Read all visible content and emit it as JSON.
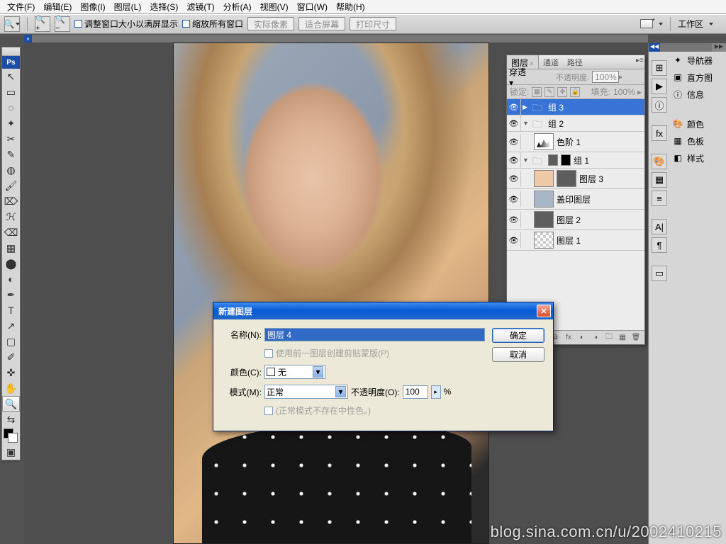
{
  "menubar": [
    "文件(F)",
    "编辑(E)",
    "图像(I)",
    "图层(L)",
    "选择(S)",
    "滤镜(T)",
    "分析(A)",
    "视图(V)",
    "窗口(W)",
    "帮助(H)"
  ],
  "optionbar": {
    "resize_check": "调整窗口大小以满屏显示",
    "zoom_all": "缩放所有窗口",
    "btn_actual": "实际像素",
    "btn_fit": "适合屏幕",
    "btn_print": "打印尺寸",
    "workspace_label": "工作区",
    "arrow": "▼"
  },
  "tools": [
    {
      "icon": "↖",
      "name": "move"
    },
    {
      "icon": "▭",
      "name": "marquee"
    },
    {
      "icon": "◌",
      "name": "lasso"
    },
    {
      "icon": "✦",
      "name": "wand"
    },
    {
      "icon": "✂",
      "name": "crop"
    },
    {
      "icon": "✎",
      "name": "slice"
    },
    {
      "icon": "◍",
      "name": "heal"
    },
    {
      "icon": "🖌",
      "name": "brush"
    },
    {
      "icon": "⌦",
      "name": "stamp"
    },
    {
      "icon": "ℋ",
      "name": "history"
    },
    {
      "icon": "⌫",
      "name": "eraser"
    },
    {
      "icon": "▦",
      "name": "gradient"
    },
    {
      "icon": "⬤",
      "name": "blur"
    },
    {
      "icon": "◐",
      "name": "dodge"
    },
    {
      "icon": "✒",
      "name": "pen"
    },
    {
      "icon": "T",
      "name": "type"
    },
    {
      "icon": "↗",
      "name": "path-sel"
    },
    {
      "icon": "▢",
      "name": "shape"
    },
    {
      "icon": "✐",
      "name": "notes"
    },
    {
      "icon": "✜",
      "name": "eyedrop"
    },
    {
      "icon": "✋",
      "name": "hand"
    },
    {
      "icon": "🔍",
      "name": "zoom",
      "sel": true
    },
    {
      "icon": "⇆",
      "name": "swap"
    }
  ],
  "right_panels": {
    "col2": [
      {
        "icon": "✦",
        "label": "导航器"
      },
      {
        "icon": "▣",
        "label": "直方图"
      },
      {
        "icon": "ⓘ",
        "label": "信息"
      },
      {
        "gap": true
      },
      {
        "icon": "🎨",
        "label": "颜色"
      },
      {
        "icon": "▦",
        "label": "色板"
      },
      {
        "icon": "◧",
        "label": "样式"
      }
    ],
    "col1_icons": [
      "⊞",
      "▶",
      "❀",
      "⊕",
      "fx",
      "▦",
      "≡",
      "⧉",
      "A|",
      "¶",
      "",
      "▭"
    ]
  },
  "layers": {
    "tabs": [
      "图层",
      "通道",
      "路径"
    ],
    "active_tab": 0,
    "blend": "穿透",
    "opacity_label": "不透明度:",
    "opacity": "100%",
    "lock_label": "锁定:",
    "fill_label": "填充:",
    "fill": "100%",
    "rows": [
      {
        "kind": "group",
        "name": "组 3",
        "sel": true,
        "open": false
      },
      {
        "kind": "group",
        "name": "组 2",
        "open": true
      },
      {
        "kind": "adj",
        "name": "色阶 1",
        "thumb": "levels",
        "indent": 1
      },
      {
        "kind": "group",
        "name": "组 1",
        "open": true,
        "masks": [
          "gray",
          "black"
        ]
      },
      {
        "kind": "layer",
        "name": "图层 3",
        "thumb": "skin",
        "indent": 1,
        "mask": "gray"
      },
      {
        "kind": "layer",
        "name": "盖印图层",
        "thumb": "img",
        "indent": 1
      },
      {
        "kind": "layer",
        "name": "图层 2",
        "thumb": "gray",
        "indent": 1
      },
      {
        "kind": "layer",
        "name": "图层 1",
        "thumb": "check",
        "indent": 1
      }
    ]
  },
  "dialog": {
    "title": "新建图层",
    "name_label": "名称(N):",
    "name_value": "图层 4",
    "clip_label": "使用前一图层创建剪贴蒙版(P)",
    "color_label": "颜色(C):",
    "color_value": "无",
    "mode_label": "模式(M):",
    "mode_value": "正常",
    "opacity_label": "不透明度(O):",
    "opacity_value": "100",
    "opacity_suffix": "%",
    "neutral_label": "(正常模式不存在中性色。)",
    "ok": "确定",
    "cancel": "取消"
  },
  "watermark": "blog.sina.com.cn/u/2002410215"
}
